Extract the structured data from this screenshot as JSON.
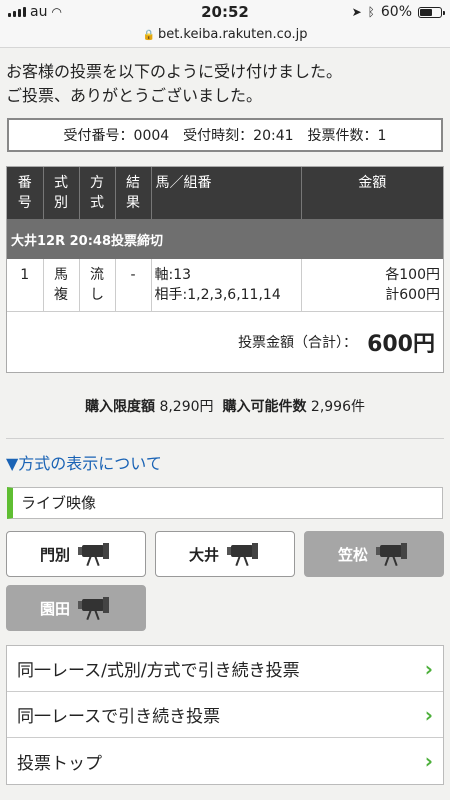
{
  "status": {
    "carrier": "au",
    "time": "20:52",
    "battery": "60%",
    "battery_level": 0.6
  },
  "url": "bet.keiba.rakuten.co.jp",
  "message": [
    "お客様の投票を以下のように受け付けました。",
    "ご投票、ありがとうございました。"
  ],
  "receipt": {
    "number": "受付番号：0004",
    "time": "受付時刻：20:41",
    "count": "投票件数：1"
  },
  "ticket": {
    "headers": {
      "no": [
        "番",
        "号"
      ],
      "shiki": [
        "式",
        "別"
      ],
      "houshiki": [
        "方",
        "式"
      ],
      "result": [
        "結",
        "果"
      ],
      "horse": "馬／組番",
      "amount": "金額"
    },
    "race": "大井12R 20:48投票締切",
    "row": {
      "no": "1",
      "shiki": [
        "馬",
        "複"
      ],
      "houshiki": [
        "流",
        "し"
      ],
      "result": "-",
      "axis": "軸:13",
      "partners": "相手:1,2,3,6,11,14",
      "each": "各100円",
      "sum": "計600円"
    },
    "total_label": "投票金額（合計）：",
    "total_amount": "600円"
  },
  "limit": {
    "label1": "購入限度額",
    "value1": "8,290円",
    "label2": "購入可能件数",
    "value2": "2,996件"
  },
  "howto_link": "▼方式の表示について",
  "live": {
    "header": "ライブ映像",
    "tracks": [
      {
        "name": "門別",
        "enabled": true
      },
      {
        "name": "大井",
        "enabled": true
      },
      {
        "name": "笠松",
        "enabled": false
      },
      {
        "name": "園田",
        "enabled": false
      }
    ]
  },
  "nav": [
    "同一レース/式別/方式で引き続き投票",
    "同一レースで引き続き投票",
    "投票トップ"
  ]
}
